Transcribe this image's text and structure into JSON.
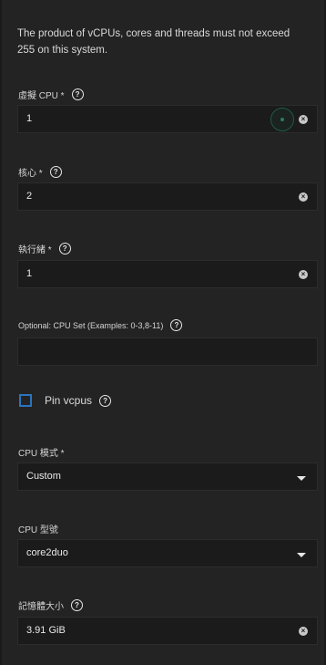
{
  "notice": "The product of vCPUs, cores and threads must not exceed 255 on this system.",
  "fields": {
    "vcpu": {
      "label": "虛擬 CPU *",
      "value": "1"
    },
    "cores": {
      "label": "核心 *",
      "value": "2"
    },
    "threads": {
      "label": "執行緒 *",
      "value": "1"
    },
    "cpuset": {
      "label": "Optional: CPU Set (Examples: 0-3,8-11)",
      "value": ""
    },
    "pin": {
      "label": "Pin vcpus",
      "checked": false
    },
    "cpu_mode": {
      "label": "CPU 模式 *",
      "value": "Custom"
    },
    "cpu_model": {
      "label": "CPU 型號",
      "value": "core2duo"
    },
    "memory": {
      "label": "記憶體大小",
      "value": "3.91 GiB"
    }
  },
  "icons": {
    "help": "help-circle-icon",
    "clear": "clear-circle-icon",
    "dropdown": "caret-down-icon"
  },
  "colors": {
    "background": "#232323",
    "field": "#1b1b1b",
    "checkbox_border": "#2a74c0"
  }
}
